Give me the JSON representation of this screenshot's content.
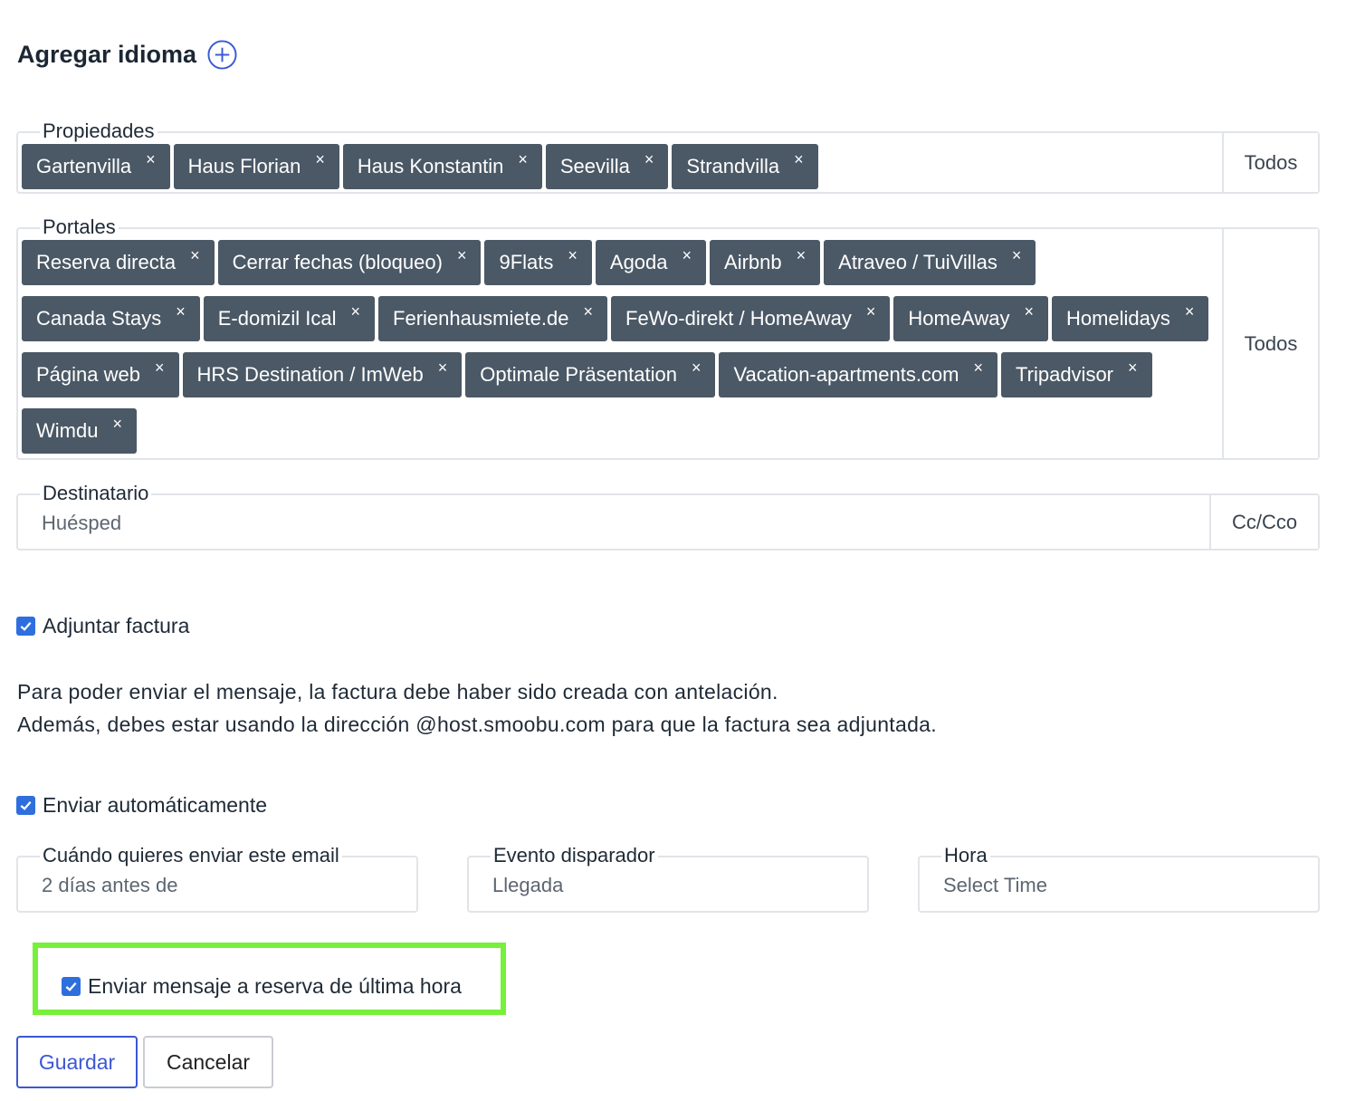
{
  "header": {
    "title": "Agregar idioma"
  },
  "properties": {
    "label": "Propiedades",
    "tags": [
      "Gartenvilla",
      "Haus Florian",
      "Haus Konstantin",
      "Seevilla",
      "Strandvilla"
    ],
    "all_button": "Todos"
  },
  "portals": {
    "label": "Portales",
    "tags": [
      "Reserva directa",
      "Cerrar fechas (bloqueo)",
      "9Flats",
      "Agoda",
      "Airbnb",
      "Atraveo / TuiVillas",
      "Canada Stays",
      "E-domizil Ical",
      "Ferienhausmiete.de",
      "FeWo-direkt / HomeAway",
      "HomeAway",
      "Homelidays",
      "Página web",
      "HRS Destination / ImWeb",
      "Optimale Präsentation",
      "Vacation-apartments.com",
      "Tripadvisor",
      "Wimdu"
    ],
    "all_button": "Todos"
  },
  "recipient": {
    "label": "Destinatario",
    "value": "Huésped",
    "cc_button": "Cc/Cco"
  },
  "attach_invoice": {
    "label": "Adjuntar factura",
    "checked": true
  },
  "info": {
    "line1": "Para poder enviar el mensaje, la factura debe haber sido creada con antelación.",
    "line2": "Además, debes estar usando la dirección @host.smoobu.com para que la factura sea adjuntada."
  },
  "auto_send": {
    "label": "Enviar automáticamente",
    "checked": true
  },
  "when": {
    "label": "Cuándo quieres enviar este email",
    "value": "2 días antes de"
  },
  "trigger": {
    "label": "Evento disparador",
    "value": "Llegada"
  },
  "time": {
    "label": "Hora",
    "placeholder": "Select Time"
  },
  "last_minute": {
    "label": "Enviar mensaje a reserva de última hora",
    "checked": true
  },
  "actions": {
    "save": "Guardar",
    "cancel": "Cancelar"
  },
  "colors": {
    "tag_bg": "#4b5866",
    "accent": "#3c57d4",
    "checkbox": "#2f6fdd",
    "highlight": "#77f03b"
  }
}
